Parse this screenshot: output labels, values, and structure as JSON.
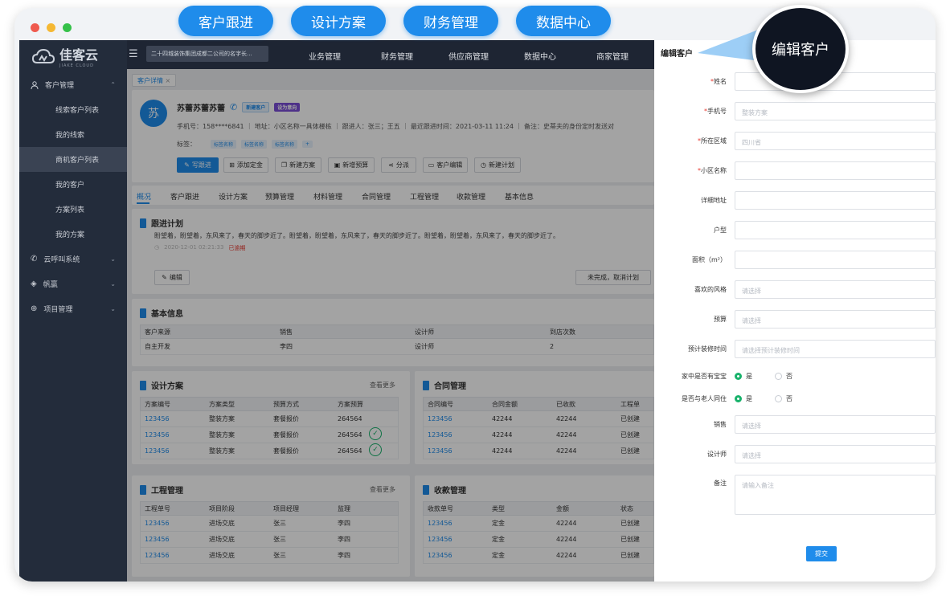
{
  "top_pills": [
    "客户跟进",
    "设计方案",
    "财务管理",
    "数据中心"
  ],
  "callout": "编辑客户",
  "colors": {
    "accent": "#1f8ceb",
    "sidebar": "#232c3b",
    "success": "#18b26b",
    "danger": "#e8382f"
  },
  "logo": {
    "name": "佳客云",
    "sub": "JIAKE CLOUD"
  },
  "sidebar": {
    "groups": [
      {
        "label": "客户管理",
        "icon": "user-icon",
        "expanded": true
      },
      {
        "label": "云呼叫系统",
        "icon": "phone-icon"
      },
      {
        "label": "帆赢",
        "icon": "sail-icon"
      },
      {
        "label": "项目管理",
        "icon": "globe-icon"
      }
    ],
    "items": [
      "线索客户列表",
      "我的线索",
      "商机客户列表",
      "我的客户",
      "方案列表",
      "我的方案"
    ],
    "active_item": "商机客户列表"
  },
  "topbar": {
    "company": "二十四城装饰集团成都二公司的名字长...",
    "tabs": [
      "业务管理",
      "财务管理",
      "供应商管理",
      "数据中心",
      "商家管理"
    ]
  },
  "breadcrumb_tab": "客户详情",
  "customer": {
    "avatar": "苏",
    "name": "苏蕾苏蕾苏蕾",
    "badge_new": "新建客户",
    "badge_intent": "设为意向",
    "info": "手机号：158****6841  ｜ 地址：小区名称一具体楼栋  ｜ 跟进人：张三；王五  ｜ 最近跟进时间：2021-03-11 11:24  ｜ 备注：史蒂夫的身份定时发送对",
    "tags_label": "标签：",
    "tags": [
      "标签名称",
      "标签名称",
      "标签名称"
    ],
    "tag_add": "+"
  },
  "actions": [
    "写跟进",
    "添加定金",
    "新建方案",
    "新增预算",
    "分派",
    "客户编辑",
    "新建计划"
  ],
  "nav_tabs": [
    "概况",
    "客户跟进",
    "设计方案",
    "预算管理",
    "材料管理",
    "合同管理",
    "工程管理",
    "收款管理",
    "基本信息"
  ],
  "follow_plan": {
    "title": "跟进计划",
    "text": "盼望着，盼望着，东风来了，春天的脚步近了。盼望着，盼望着，东风来了，春天的脚步近了。盼望着，盼望着，东风来了，春天的脚步近了。",
    "time": "2020-12-01 02:21:33",
    "status": "已逾期",
    "edit": "编辑",
    "cancel": "未完成，取消计划"
  },
  "basic_info": {
    "title": "基本信息",
    "headers": [
      "客户来源",
      "销售",
      "设计师",
      "到店次数"
    ],
    "row": [
      "自主开发",
      "李四",
      "设计师",
      "2"
    ]
  },
  "design": {
    "title": "设计方案",
    "more": "查看更多",
    "headers": [
      "方案编号",
      "方案类型",
      "预算方式",
      "方案预算"
    ],
    "rows": [
      [
        "123456",
        "整装方案",
        "套餐报价",
        "264564"
      ],
      [
        "123456",
        "整装方案",
        "套餐报价",
        "264564"
      ],
      [
        "123456",
        "整装方案",
        "套餐报价",
        "264564"
      ]
    ]
  },
  "contract": {
    "title": "合同管理",
    "headers": [
      "合同编号",
      "合同金额",
      "已收款",
      "工程单"
    ],
    "rows": [
      [
        "123456",
        "42244",
        "42244",
        "已创建"
      ],
      [
        "123456",
        "42244",
        "42244",
        "已创建"
      ],
      [
        "123456",
        "42244",
        "42244",
        "已创建"
      ]
    ]
  },
  "project": {
    "title": "工程管理",
    "more": "查看更多",
    "headers": [
      "工程单号",
      "项目阶段",
      "项目经理",
      "监理"
    ],
    "rows": [
      [
        "123456",
        "进场交底",
        "张三",
        "李四"
      ],
      [
        "123456",
        "进场交底",
        "张三",
        "李四"
      ],
      [
        "123456",
        "进场交底",
        "张三",
        "李四"
      ]
    ]
  },
  "payment": {
    "title": "收款管理",
    "headers": [
      "收款单号",
      "类型",
      "金额",
      "状态"
    ],
    "rows": [
      [
        "123456",
        "定金",
        "42244",
        "已创建"
      ],
      [
        "123456",
        "定金",
        "42244",
        "已创建"
      ],
      [
        "123456",
        "定金",
        "42244",
        "已创建"
      ]
    ]
  },
  "edit_panel": {
    "title": "编辑客户",
    "fields": [
      {
        "label": "姓名",
        "req": true,
        "placeholder": ""
      },
      {
        "label": "手机号",
        "req": true,
        "placeholder": "整装方案"
      },
      {
        "label": "所在区域",
        "req": true,
        "placeholder": "四川省"
      },
      {
        "label": "小区名称",
        "req": true,
        "placeholder": ""
      },
      {
        "label": "详细地址",
        "req": false,
        "placeholder": ""
      },
      {
        "label": "户型",
        "req": false,
        "placeholder": ""
      },
      {
        "label": "面积（m²）",
        "req": false,
        "placeholder": ""
      },
      {
        "label": "喜欢的风格",
        "req": false,
        "placeholder": "请选择"
      },
      {
        "label": "预算",
        "req": false,
        "placeholder": "请选择"
      },
      {
        "label": "预计装修时间",
        "req": false,
        "placeholder": "请选择预计装修时间"
      }
    ],
    "radios": [
      {
        "label": "家中是否有宝宝",
        "yes": "是",
        "no": "否"
      },
      {
        "label": "是否与老人同住",
        "yes": "是",
        "no": "否"
      }
    ],
    "sales_label": "销售",
    "sales_ph": "请选择",
    "designer_label": "设计师",
    "designer_ph": "请选择",
    "note_label": "备注",
    "note_ph": "请输入备注",
    "submit": "提交"
  }
}
